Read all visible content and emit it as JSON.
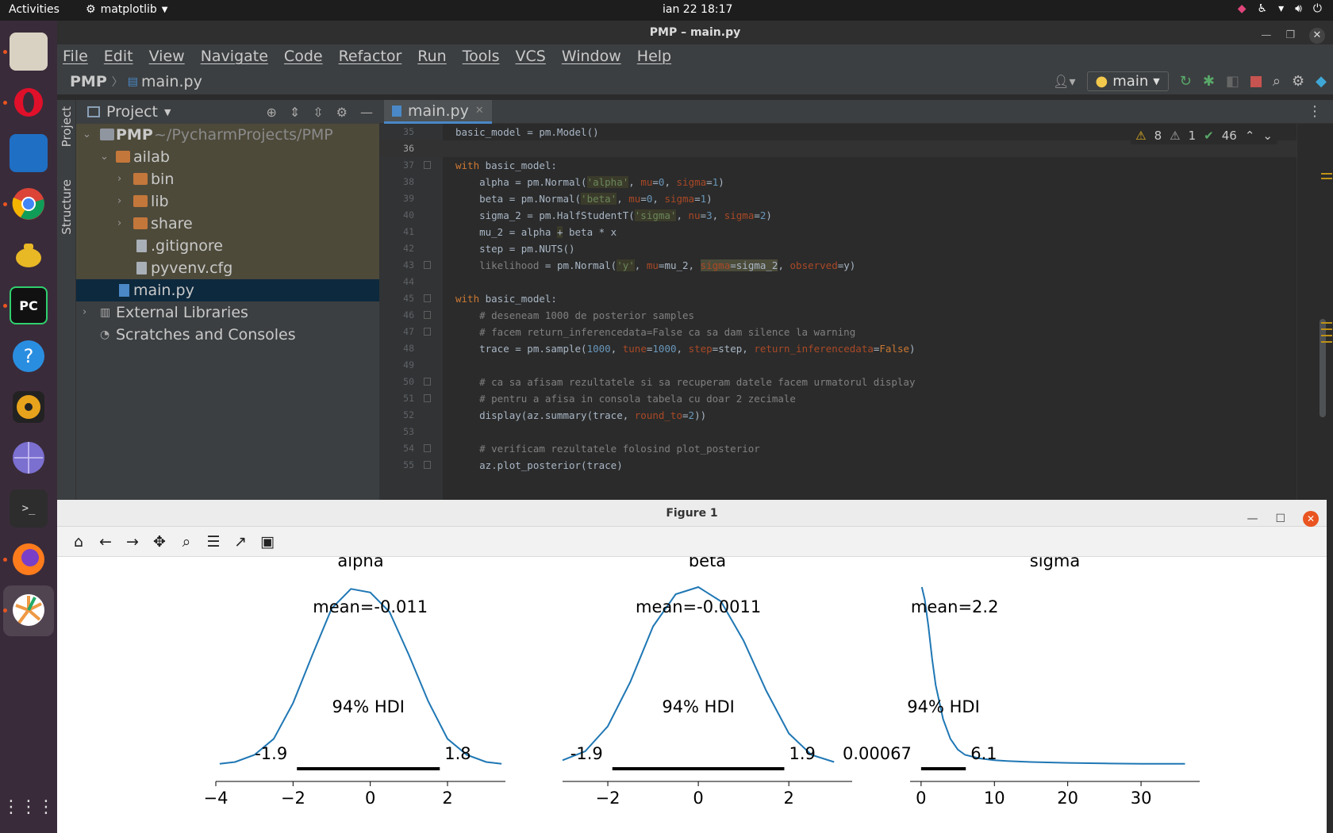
{
  "topbar": {
    "activities": "Activities",
    "app_menu": "matplotlib",
    "clock": "ian 22  18:17"
  },
  "dock": {
    "items": [
      "files",
      "opera",
      "document-viewer",
      "chrome",
      "teapot-app",
      "pycharm",
      "help",
      "rhythmbox",
      "web-browser",
      "terminal",
      "firefox",
      "matplotlib-figure",
      "show-apps"
    ]
  },
  "ide": {
    "window_title": "PMP – main.py",
    "menu": [
      "File",
      "Edit",
      "View",
      "Navigate",
      "Code",
      "Refactor",
      "Run",
      "Tools",
      "VCS",
      "Window",
      "Help"
    ],
    "breadcrumb_root": "PMP",
    "breadcrumb_file": "main.py",
    "run_config": "main",
    "side_tabs": {
      "project": "Project",
      "structure": "Structure"
    },
    "project_panel_title": "Project",
    "tree": {
      "root": "PMP",
      "root_path": "~/PycharmProjects/PMP",
      "ailab": "ailab",
      "bin": "bin",
      "lib": "lib",
      "share": "share",
      "gitignore": ".gitignore",
      "pyvenv": "pyvenv.cfg",
      "main": "main.py",
      "external": "External Libraries",
      "scratches": "Scratches and Consoles"
    },
    "editor_tab": "main.py",
    "inspections": {
      "warnings": "8",
      "weak_warnings": "1",
      "ok": "46"
    }
  },
  "code_lines": [
    {
      "n": "35",
      "text": "basic_model = pm.Model()"
    },
    {
      "n": "36",
      "text": ""
    },
    {
      "n": "37",
      "text": "with basic_model:"
    },
    {
      "n": "38",
      "text": "alpha = pm.Normal('alpha', mu=0, sigma=1)"
    },
    {
      "n": "39",
      "text": "beta = pm.Normal('beta', mu=0, sigma=1)"
    },
    {
      "n": "40",
      "text": "sigma_2 = pm.HalfStudentT('sigma', nu=3, sigma=2)"
    },
    {
      "n": "41",
      "text": "mu_2 = alpha + beta * x"
    },
    {
      "n": "42",
      "text": "step = pm.NUTS()"
    },
    {
      "n": "43",
      "text": "likelihood = pm.Normal('y', mu=mu_2, sigma=sigma_2, observed=y)"
    },
    {
      "n": "44",
      "text": ""
    },
    {
      "n": "45",
      "text": "with basic_model:"
    },
    {
      "n": "46",
      "text": "# deseneam 1000 de posterior samples"
    },
    {
      "n": "47",
      "text": "# facem return_inferencedata=False ca sa dam silence la warning"
    },
    {
      "n": "48",
      "text": "trace = pm.sample(1000, tune=1000, step=step, return_inferencedata=False)"
    },
    {
      "n": "49",
      "text": ""
    },
    {
      "n": "50",
      "text": "# ca sa afisam rezultatele si sa recuperam datele facem urmatorul display"
    },
    {
      "n": "51",
      "text": "# pentru a afisa in consola tabela cu doar 2 zecimale"
    },
    {
      "n": "52",
      "text": "display(az.summary(trace, round_to=2))"
    },
    {
      "n": "53",
      "text": ""
    },
    {
      "n": "54",
      "text": "# verificam rezultatele folosind plot_posterior"
    },
    {
      "n": "55",
      "text": "az.plot_posterior(trace)"
    }
  ],
  "figure": {
    "window_title": "Figure 1",
    "toolbar": [
      "home",
      "back",
      "forward",
      "pan",
      "zoom",
      "configure-subplots",
      "edit-axes",
      "save"
    ]
  },
  "chart_data": [
    {
      "type": "line",
      "title": "alpha",
      "mean_label": "mean=-0.011",
      "hdi_label": "94% HDI",
      "hdi": [
        -1.9,
        1.8
      ],
      "hdi_low_label": "-1.9",
      "hdi_high_label": "1.8",
      "xlim": [
        -4,
        3.5
      ],
      "xticks": [
        "−4",
        "−2",
        "0",
        "2"
      ],
      "color": "#1f77b4",
      "x": [
        -3.9,
        -3.5,
        -3.0,
        -2.5,
        -2.0,
        -1.5,
        -1.0,
        -0.5,
        0.0,
        0.5,
        1.0,
        1.5,
        2.0,
        2.5,
        3.0,
        3.4
      ],
      "y": [
        0.01,
        0.02,
        0.06,
        0.15,
        0.35,
        0.62,
        0.88,
        0.99,
        0.97,
        0.86,
        0.62,
        0.36,
        0.15,
        0.06,
        0.02,
        0.01
      ]
    },
    {
      "type": "line",
      "title": "beta",
      "mean_label": "mean=-0.0011",
      "hdi_label": "94% HDI",
      "hdi": [
        -1.9,
        1.9
      ],
      "hdi_low_label": "-1.9",
      "hdi_high_label": "1.9",
      "xlim": [
        -3.0,
        3.4
      ],
      "xticks": [
        "−2",
        "0",
        "2"
      ],
      "color": "#1f77b4",
      "x": [
        -3.0,
        -2.5,
        -2.0,
        -1.5,
        -1.0,
        -0.5,
        0.0,
        0.5,
        1.0,
        1.5,
        2.0,
        2.5,
        3.0
      ],
      "y": [
        0.03,
        0.08,
        0.22,
        0.47,
        0.78,
        0.96,
        1.0,
        0.92,
        0.7,
        0.42,
        0.18,
        0.06,
        0.02
      ]
    },
    {
      "type": "line",
      "title": "sigma",
      "mean_label": "mean=2.2",
      "hdi_label": "94% HDI",
      "hdi": [
        0.00067,
        6.1
      ],
      "hdi_low_label": "0.00067",
      "hdi_high_label": "6.1",
      "xlim": [
        -1.5,
        38
      ],
      "xticks": [
        "0",
        "10",
        "20",
        "30"
      ],
      "color": "#1f77b4",
      "x": [
        0.1,
        0.5,
        1.0,
        1.5,
        2.0,
        3.0,
        4.0,
        5.0,
        6.0,
        8.0,
        10.0,
        12.0,
        15.0,
        20.0,
        25.0,
        30.0,
        36.0
      ],
      "y": [
        1.0,
        0.93,
        0.78,
        0.6,
        0.45,
        0.26,
        0.15,
        0.09,
        0.06,
        0.04,
        0.03,
        0.025,
        0.02,
        0.015,
        0.012,
        0.01,
        0.01
      ]
    }
  ]
}
